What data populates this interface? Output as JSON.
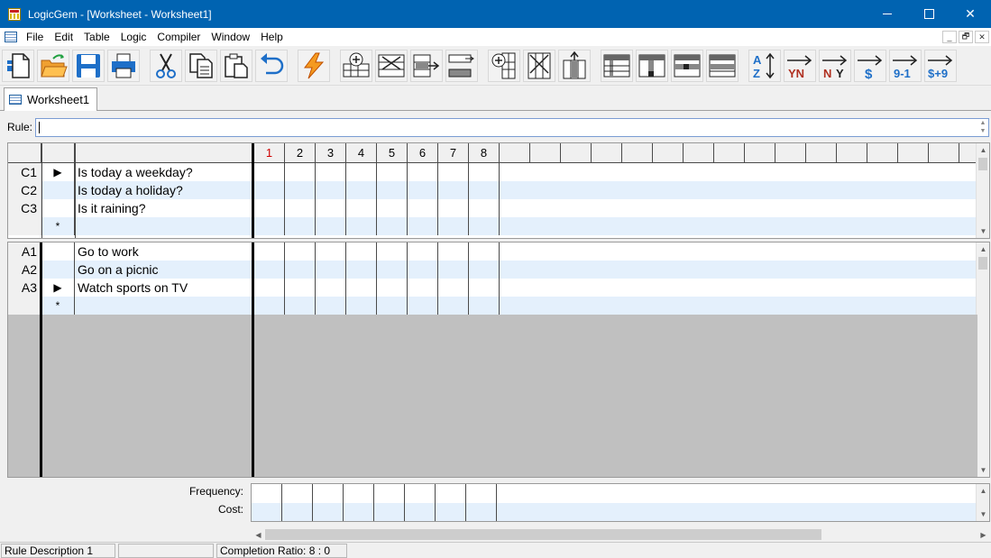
{
  "window": {
    "title": "LogicGem - [Worksheet - Worksheet1]",
    "controls": {
      "minimize": "—",
      "maximize": "☐",
      "close": "✕"
    }
  },
  "menu": {
    "items": [
      {
        "label": "File"
      },
      {
        "label": "Edit"
      },
      {
        "label": "Table"
      },
      {
        "label": "Logic"
      },
      {
        "label": "Compiler"
      },
      {
        "label": "Window"
      },
      {
        "label": "Help"
      }
    ],
    "mdi_controls": [
      "_",
      "🗗",
      "✕"
    ]
  },
  "toolbar": {
    "buttons": [
      {
        "name": "new-icon"
      },
      {
        "name": "open-icon"
      },
      {
        "name": "save-icon"
      },
      {
        "name": "print-icon"
      },
      {
        "name": "cut-icon"
      },
      {
        "name": "copy-icon"
      },
      {
        "name": "paste-icon"
      },
      {
        "name": "undo-icon"
      },
      {
        "name": "process-icon"
      },
      {
        "name": "insert-row-icon"
      },
      {
        "name": "delete-row-icon"
      },
      {
        "name": "move-row-icon"
      },
      {
        "name": "move-row-down-icon"
      },
      {
        "name": "insert-column-icon"
      },
      {
        "name": "delete-column-icon"
      },
      {
        "name": "move-column-icon"
      },
      {
        "name": "table-view-1-icon"
      },
      {
        "name": "table-view-2-icon"
      },
      {
        "name": "table-view-3-icon"
      },
      {
        "name": "table-view-4-icon"
      },
      {
        "name": "sort-az-icon"
      },
      {
        "name": "sort-yn-icon"
      },
      {
        "name": "sort-ny-icon"
      },
      {
        "name": "sort-cost-icon"
      },
      {
        "name": "sort-91-icon"
      },
      {
        "name": "sort-cost-plus-icon"
      }
    ],
    "sort_labels": {
      "az_a": "A",
      "az_z": "Z",
      "yn": "YN",
      "ny_n": "N",
      "ny_y": "Y",
      "dollar": "$",
      "nine_one": "9-1",
      "dollar_nine": "$+9"
    }
  },
  "tabs": [
    {
      "label": "Worksheet1"
    }
  ],
  "rule": {
    "label": "Rule:",
    "value": ""
  },
  "grid": {
    "rule_columns": [
      "1",
      "2",
      "3",
      "4",
      "5",
      "6",
      "7",
      "8"
    ],
    "active_rule": "1",
    "conditions": [
      {
        "id": "C1",
        "marker": "▶",
        "text": "Is today a weekday?"
      },
      {
        "id": "C2",
        "marker": "",
        "text": "Is today a holiday?"
      },
      {
        "id": "C3",
        "marker": "",
        "text": "Is it raining?"
      },
      {
        "id": "",
        "marker": "*",
        "text": ""
      }
    ],
    "actions": [
      {
        "id": "A1",
        "marker": "",
        "text": "Go to work"
      },
      {
        "id": "A2",
        "marker": "",
        "text": "Go on a picnic"
      },
      {
        "id": "A3",
        "marker": "▶",
        "text": "Watch sports on TV"
      },
      {
        "id": "",
        "marker": "*",
        "text": ""
      }
    ]
  },
  "footer": {
    "frequency_label": "Frequency:",
    "cost_label": "Cost:"
  },
  "statusbar": {
    "description": "Rule Description 1",
    "middle": "",
    "completion": "Completion Ratio: 8 : 0"
  },
  "colors": {
    "titlebar": "#0063b1",
    "active_rule": "#d00000",
    "alt_row": "#e4f0fc",
    "empty_area": "#c0c0c0"
  }
}
